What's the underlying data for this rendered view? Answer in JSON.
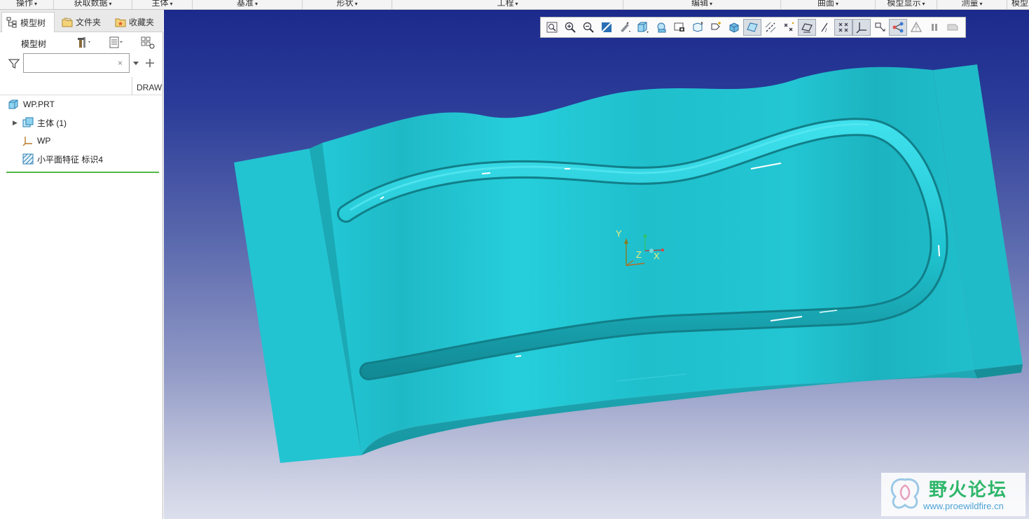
{
  "ribbon": {
    "groups": [
      "操作",
      "获取数据",
      "主体",
      "基准",
      "形状",
      "工程",
      "编辑",
      "曲面",
      "模型显示",
      "测量",
      "模型"
    ]
  },
  "left_panel": {
    "tabs": [
      {
        "label": "模型树",
        "icon": "model-tree-icon",
        "active": true
      },
      {
        "label": "文件夹",
        "icon": "folder-icon",
        "active": false
      },
      {
        "label": "收藏夹",
        "icon": "favorites-icon",
        "active": false
      }
    ],
    "tree_title": "模型树",
    "filter": {
      "value": "",
      "placeholder": "",
      "clear_symbol": "×"
    },
    "column_header": "DRAW",
    "tree_items": [
      {
        "label": "WP.PRT",
        "icon": "part-icon",
        "expandable": false
      },
      {
        "label": "主体 (1)",
        "icon": "body-icon",
        "expandable": true
      },
      {
        "label": "WP",
        "icon": "coordinate-system-icon",
        "expandable": false
      },
      {
        "label": "小平面特征 标识4",
        "icon": "facet-feature-icon",
        "expandable": false
      }
    ]
  },
  "graphics_toolbar": {
    "buttons": [
      {
        "icon": "refit-icon",
        "active": false
      },
      {
        "icon": "zoom-in-icon",
        "active": false
      },
      {
        "icon": "zoom-out-icon",
        "active": false
      },
      {
        "icon": "repaint-icon",
        "active": false
      },
      {
        "icon": "display-style-icon",
        "active": false
      },
      {
        "icon": "saved-orientations-icon",
        "active": false
      },
      {
        "icon": "view-manager-icon",
        "active": false
      },
      {
        "icon": "perspective-view-icon",
        "active": false
      },
      {
        "icon": "section-icon",
        "active": false
      },
      {
        "icon": "annotation-display-icon",
        "active": false
      },
      {
        "icon": "appearance-icon",
        "active": false
      },
      {
        "icon": "plane-display-icon",
        "active": true
      },
      {
        "icon": "axis-display-icon",
        "active": false
      },
      {
        "icon": "point-display-icon",
        "active": false
      },
      {
        "icon": "plane-tag-display-icon",
        "active": true
      },
      {
        "icon": "axis-tag-display-icon",
        "active": false
      },
      {
        "icon": "point-tag-display-icon",
        "active": true
      },
      {
        "icon": "csys-display-icon",
        "active": true
      },
      {
        "icon": "spin-center-icon",
        "active": false
      },
      {
        "icon": "model-tree-display-icon",
        "active": true
      },
      {
        "icon": "triangle-display-icon",
        "active": false
      },
      {
        "icon": "pause-icon",
        "active": false
      },
      {
        "icon": "stop-icon",
        "active": false
      }
    ]
  },
  "viewport": {
    "model_color": "#22c4d2",
    "triad_labels": {
      "y": "Y",
      "z": "Z",
      "x": "X"
    }
  },
  "watermark": {
    "title": "野火论坛",
    "url": "www.proewildfire.cn"
  }
}
